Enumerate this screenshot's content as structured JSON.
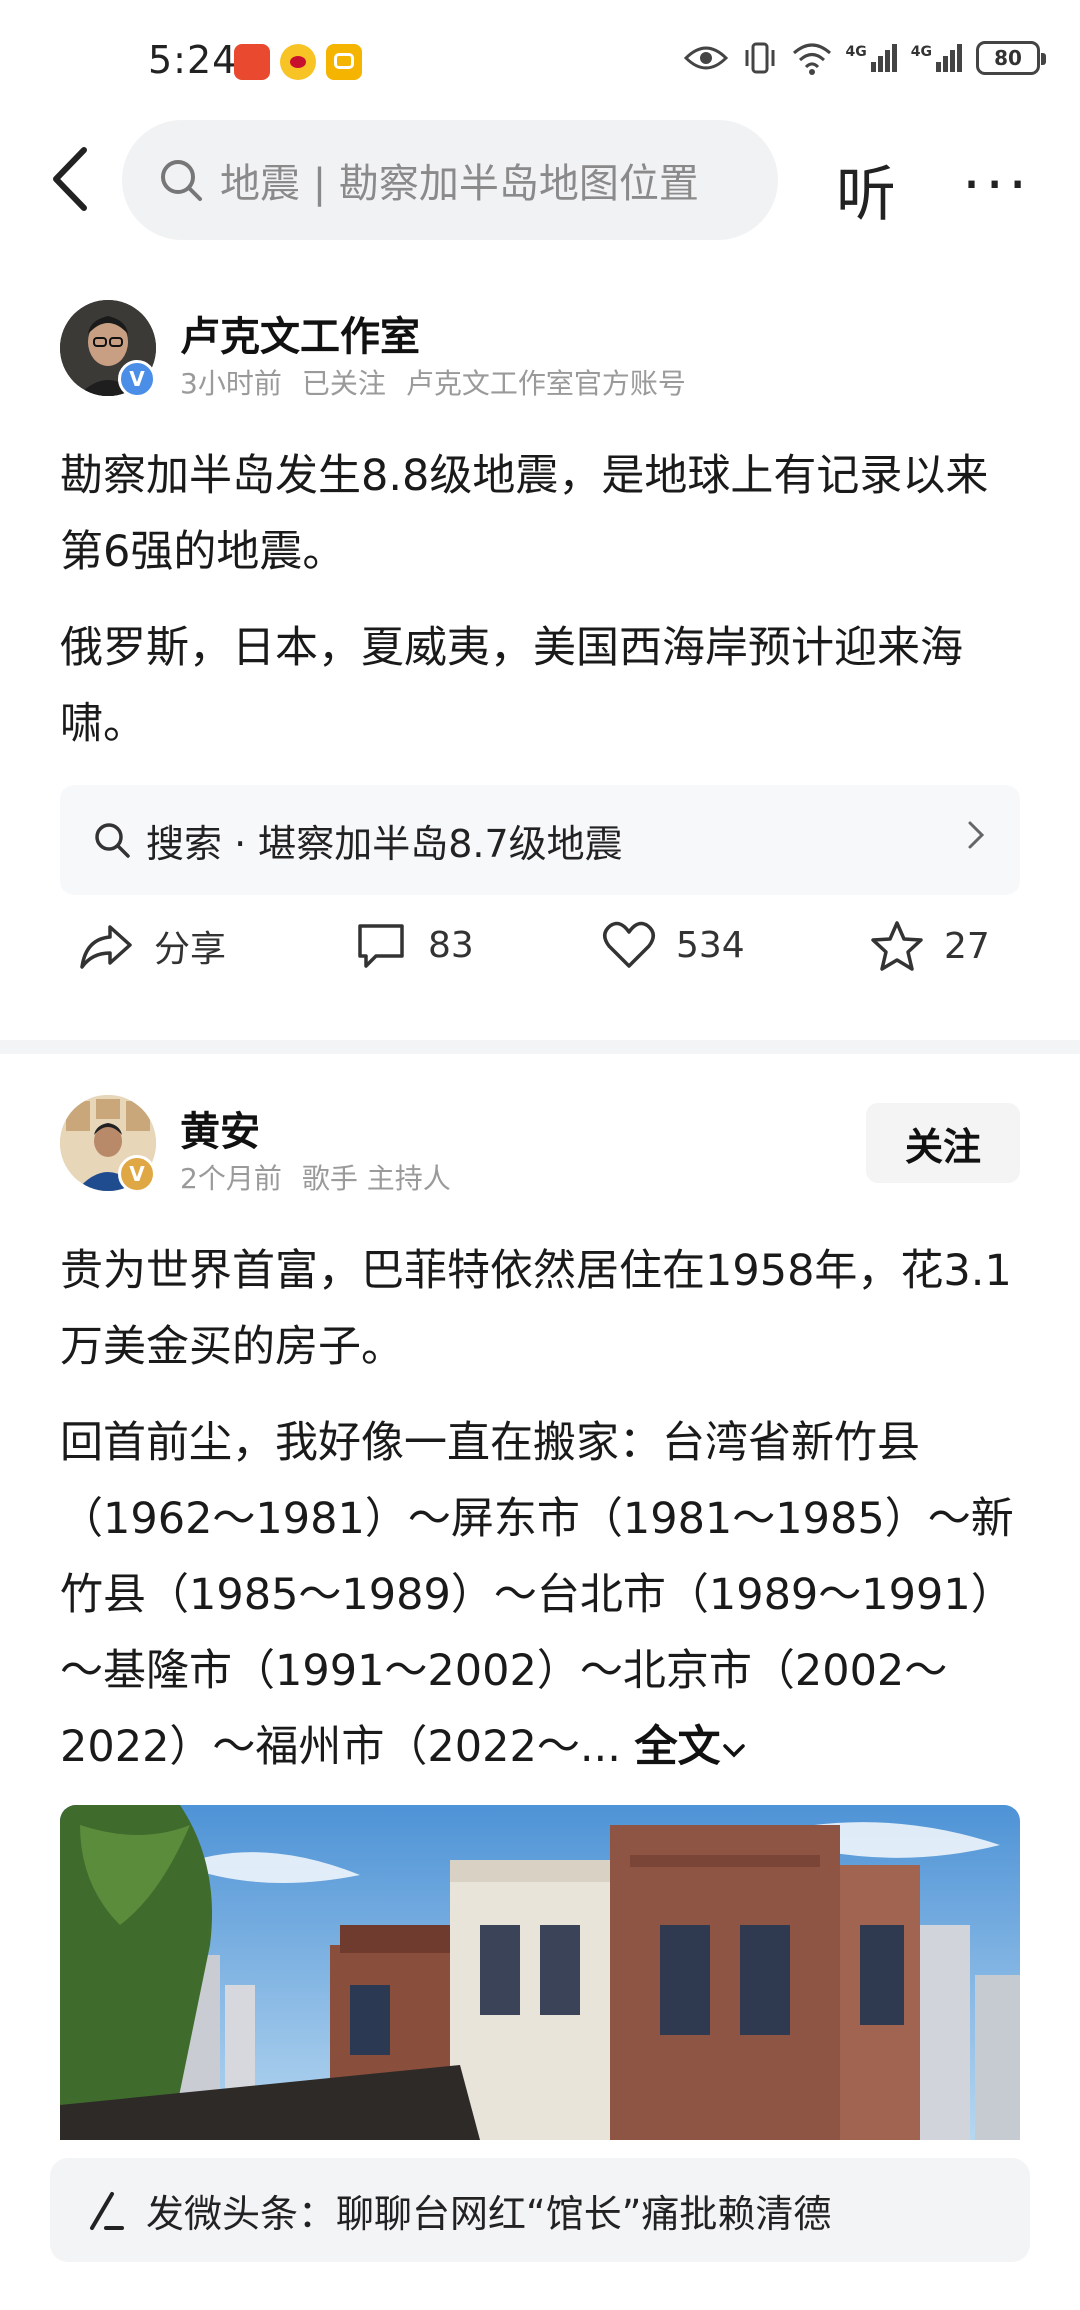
{
  "status_bar": {
    "time": "5:24",
    "battery": "80",
    "network_1": "4G",
    "network_2": "4G"
  },
  "top_bar": {
    "search_text": "地震 | 勘察加半岛地图位置",
    "listen_label": "听",
    "more_label": "···"
  },
  "post1": {
    "author": "卢克文工作室",
    "time": "3小时前",
    "follow_status": "已关注",
    "description": "卢克文工作室官方账号",
    "paragraph1": "勘察加半岛发生8.8级地震，是地球上有记录以来第6强的地震。",
    "paragraph2": "俄罗斯，日本，夏威夷，美国西海岸预计迎来海啸。",
    "search_suggest": "搜索 · 堪察加半岛8.7级地震",
    "actions": {
      "share": "分享",
      "comments": "83",
      "likes": "534",
      "favorites": "27"
    }
  },
  "post2": {
    "author": "黄安",
    "time": "2个月前",
    "description": "歌手 主持人",
    "follow_button": "关注",
    "paragraph1": "贵为世界首富，巴菲特依然居住在1958年，花3.1万美金买的房子。",
    "paragraph2": "回首前尘，我好像一直在搬家：台湾省新竹县（1962～1981）～屏东市（1981～1985）～新竹县（1985～1989）～台北市（1989～1991）～基隆市（1991～2002）～北京市（2002～2022）～福州市（2022～...",
    "full_text_label": "全文"
  },
  "bottom_bar": {
    "text": "发微头条：聊聊台网红“馆长”痛批赖清德"
  },
  "colors": {
    "verify_blue": "#4a8ee8",
    "verify_gold": "#e0a844",
    "weibo_orange": "#f5a623",
    "app_red": "#e8492f",
    "app_yellow": "#f7c325"
  }
}
